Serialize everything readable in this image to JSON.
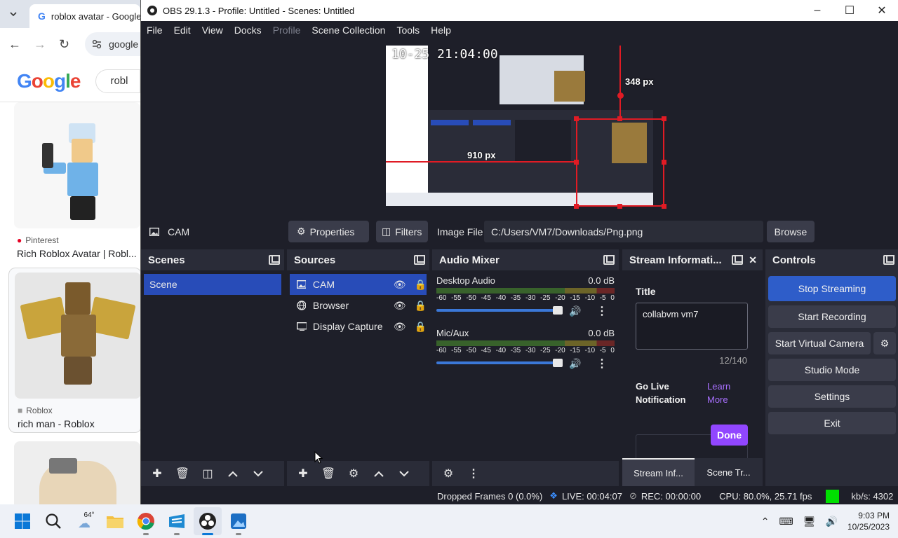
{
  "chrome": {
    "tab_title": "roblox avatar - Google S",
    "address": "google",
    "search_text": "robl",
    "results": [
      {
        "source": "Pinterest",
        "title": "Rich Roblox Avatar | Robl..."
      },
      {
        "source": "Roblox",
        "title": "rich man - Roblox"
      }
    ]
  },
  "obs": {
    "title": "OBS 29.1.3 - Profile: Untitled - Scenes: Untitled",
    "menu": [
      "File",
      "Edit",
      "View",
      "Docks",
      "Profile",
      "Scene Collection",
      "Tools",
      "Help"
    ],
    "preview": {
      "timestamp": "10-25 21:04:00",
      "label_width": "910 px",
      "label_height": "348 px"
    },
    "propbar": {
      "source_name": "CAM",
      "properties_label": "Properties",
      "filters_label": "Filters",
      "image_file_label": "Image File",
      "image_file_path": "C:/Users/VM7/Downloads/Png.png",
      "browse_label": "Browse"
    },
    "scenes": {
      "title": "Scenes",
      "items": [
        "Scene"
      ]
    },
    "sources": {
      "title": "Sources",
      "items": [
        "CAM",
        "Browser",
        "Display Capture"
      ]
    },
    "audio": {
      "title": "Audio Mixer",
      "channels": [
        {
          "name": "Desktop Audio",
          "db": "0.0 dB",
          "level": 1.0
        },
        {
          "name": "Mic/Aux",
          "db": "0.0 dB",
          "level": 1.0
        }
      ],
      "ticks": [
        "-60",
        "-55",
        "-50",
        "-45",
        "-40",
        "-35",
        "-30",
        "-25",
        "-20",
        "-15",
        "-10",
        "-5",
        "0"
      ]
    },
    "stream_info": {
      "title": "Stream Informati...",
      "title_label": "Title",
      "title_value": "collabvm vm7",
      "char_count": "12/140",
      "go_live_label": "Go Live Notification",
      "learn_more": "Learn More",
      "done_label": "Done",
      "tab1": "Stream Inf...",
      "tab2": "Scene Tr..."
    },
    "controls": {
      "title": "Controls",
      "stop_streaming": "Stop Streaming",
      "start_recording": "Start Recording",
      "start_virtual_camera": "Start Virtual Camera",
      "studio_mode": "Studio Mode",
      "settings": "Settings",
      "exit": "Exit"
    },
    "status": {
      "dropped": "Dropped Frames 0 (0.0%)",
      "live": "LIVE: 00:04:07",
      "rec": "REC: 00:00:00",
      "cpu": "CPU: 80.0%, 25.71 fps",
      "kbs": "kb/s: 4302"
    }
  },
  "taskbar": {
    "weather": "64°",
    "time": "9:03 PM",
    "date": "10/25/2023"
  },
  "colors": {
    "accent_blue": "#284cb8",
    "stop_streaming": "#2e5dc9",
    "done_purple": "#9146ff",
    "status_green": "#00e000",
    "selection_red": "#e01b24"
  }
}
